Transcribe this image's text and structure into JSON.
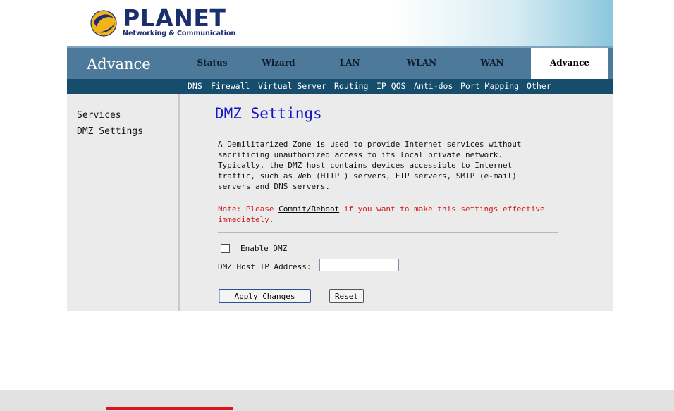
{
  "brand": {
    "name": "PLANET",
    "tagline": "Networking & Communication"
  },
  "nav": {
    "section_title": "Advance",
    "tabs": [
      {
        "label": "Status"
      },
      {
        "label": "Wizard"
      },
      {
        "label": "LAN"
      },
      {
        "label": "WLAN"
      },
      {
        "label": "WAN"
      },
      {
        "label": "Advance",
        "active": true
      }
    ],
    "subtabs": [
      {
        "label": "DNS"
      },
      {
        "label": "Firewall"
      },
      {
        "label": "Virtual Server"
      },
      {
        "label": "Routing"
      },
      {
        "label": "IP QOS"
      },
      {
        "label": "Anti-dos"
      },
      {
        "label": "Port Mapping"
      },
      {
        "label": "Other"
      }
    ]
  },
  "sidebar": {
    "items": [
      {
        "label": "Services"
      },
      {
        "label": "DMZ Settings"
      }
    ]
  },
  "main": {
    "title": "DMZ Settings",
    "description": "A Demilitarized Zone is used to provide Internet services without\nsacrificing unauthorized access to its local private network.\nTypically, the DMZ host contains devices accessible to Internet\ntraffic, such as Web (HTTP ) servers, FTP servers, SMTP (e-mail)\nservers and DNS servers.",
    "note_prefix": "Note: Please ",
    "note_link": "Commit/Reboot",
    "note_suffix": " if you want to make this settings effective immediately.",
    "enable_label": "Enable DMZ",
    "enable_checked": false,
    "ip_label": "DMZ Host IP Address:",
    "ip_value": "",
    "apply_label": "Apply Changes",
    "reset_label": "Reset"
  },
  "colors": {
    "nav_bg": "#4d7a9a",
    "subnav_bg": "#164d6c",
    "title_blue": "#1414c8",
    "note_red": "#d21a1a",
    "footer_accent": "#e0141c"
  }
}
